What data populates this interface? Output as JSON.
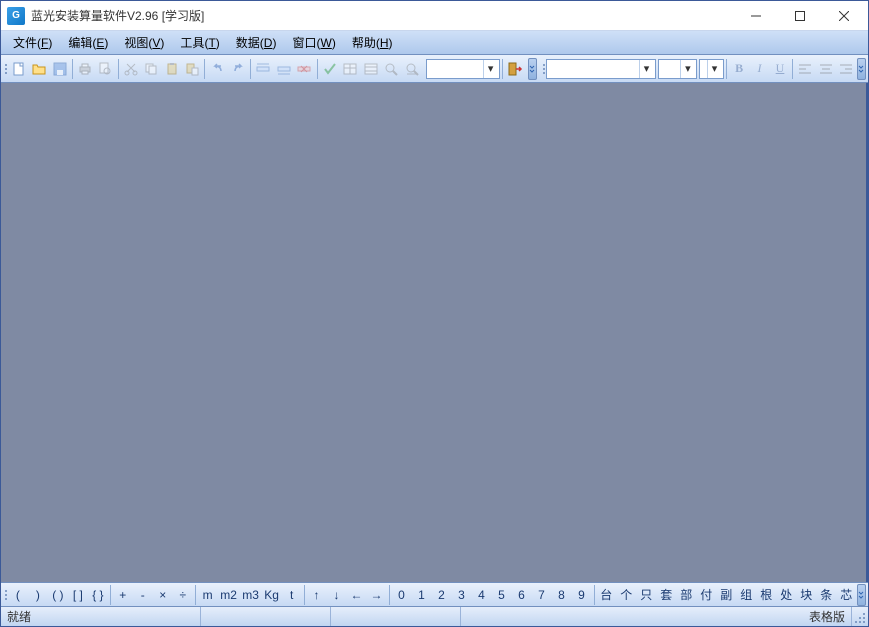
{
  "title": "蓝光安装算量软件V2.96 [学习版]",
  "menu": {
    "file": {
      "label": "文件",
      "key": "F"
    },
    "edit": {
      "label": "编辑",
      "key": "E"
    },
    "view": {
      "label": "视图",
      "key": "V"
    },
    "tool": {
      "label": "工具",
      "key": "T"
    },
    "data": {
      "label": "数据",
      "key": "D"
    },
    "window": {
      "label": "窗口",
      "key": "W"
    },
    "help": {
      "label": "帮助",
      "key": "H"
    }
  },
  "toolbar": {
    "combo1_value": "",
    "combo2_value": ""
  },
  "format": {
    "bold": "B",
    "italic": "I",
    "underline": "U"
  },
  "symbols": {
    "paren_open": "(",
    "paren_close": ")",
    "pair_paren": "( )",
    "pair_bracket": "[ ]",
    "pair_brace": "{ }",
    "plus": "+",
    "minus": "-",
    "times": "×",
    "divide": "÷",
    "m": "m",
    "m2": "m2",
    "m3": "m3",
    "kg": "Kg",
    "t": "t",
    "up": "↑",
    "down": "↓",
    "left": "←",
    "right": "→",
    "d0": "0",
    "d1": "1",
    "d2": "2",
    "d3": "3",
    "d4": "4",
    "d5": "5",
    "d6": "6",
    "d7": "7",
    "d8": "8",
    "d9": "9",
    "u_tai": "台",
    "u_ge": "个",
    "u_zhi": "只",
    "u_tao": "套",
    "u_bu": "部",
    "u_fu": "付",
    "u_fu2": "副",
    "u_zu": "组",
    "u_gen": "根",
    "u_chu": "处",
    "u_kuai": "块",
    "u_tiao": "条",
    "u_xin": "芯"
  },
  "status": {
    "ready": "就绪",
    "mode": "表格版"
  }
}
